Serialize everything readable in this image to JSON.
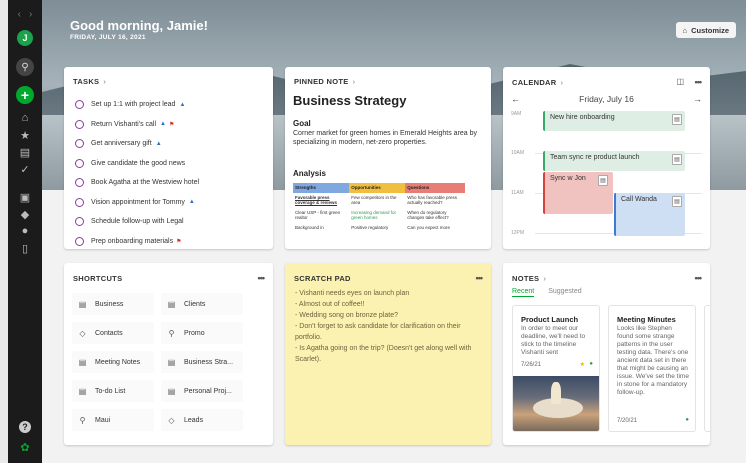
{
  "greeting": "Good morning, Jamie!",
  "date": "FRIDAY, JULY 16, 2021",
  "customize_label": "Customize",
  "sidebar": {
    "avatar_initial": "J"
  },
  "tasks": {
    "title": "TASKS",
    "items": [
      {
        "label": "Set up 1:1 with project lead",
        "flags": [
          "blue"
        ]
      },
      {
        "label": "Return Vishanti's call",
        "flags": [
          "blue",
          "red"
        ]
      },
      {
        "label": "Get anniversary gift",
        "flags": [
          "blue"
        ]
      },
      {
        "label": "Give candidate the good news",
        "flags": []
      },
      {
        "label": "Book Agatha at the Westview hotel",
        "flags": []
      },
      {
        "label": "Vision appointment for Tommy",
        "flags": [
          "blue"
        ]
      },
      {
        "label": "Schedule follow-up with Legal",
        "flags": []
      },
      {
        "label": "Prep onboarding materials",
        "flags": [
          "red"
        ]
      }
    ]
  },
  "pinned": {
    "header": "PINNED NOTE",
    "title": "Business Strategy",
    "goal_heading": "Goal",
    "goal_text": "Corner market for green homes in Emerald Heights area by specializing in modern, net-zero properties.",
    "analysis_heading": "Analysis",
    "table_headers": [
      "Strengths",
      "Opportunities",
      "Questions"
    ],
    "table_rows": [
      [
        "Favorable press coverage & reviews",
        "Few competitors in the area",
        "Who has favorable press actually reached?"
      ],
      [
        "Clear USP - first green realtor",
        "Increasing demand for green homes",
        "When do regulatory changes take effect?"
      ],
      [
        "Background in",
        "Positive regulatory",
        "Can you expect more"
      ]
    ]
  },
  "calendar": {
    "title": "CALENDAR",
    "day": "Friday, July 16",
    "hours": [
      "9AM",
      "10AM",
      "11AM",
      "12PM"
    ],
    "events": [
      "New hire onboarding",
      "Team sync re product launch",
      "Sync w Jon",
      "Call Wanda"
    ]
  },
  "shortcuts": {
    "title": "SHORTCUTS",
    "items": [
      {
        "label": "Business",
        "icon": "notebook-icon"
      },
      {
        "label": "Clients",
        "icon": "notebook-icon"
      },
      {
        "label": "Contacts",
        "icon": "tag-icon"
      },
      {
        "label": "Promo",
        "icon": "search-icon"
      },
      {
        "label": "Meeting Notes",
        "icon": "note-icon"
      },
      {
        "label": "Business Stra...",
        "icon": "note-icon"
      },
      {
        "label": "To-do List",
        "icon": "note-icon"
      },
      {
        "label": "Personal Proj...",
        "icon": "note-icon"
      },
      {
        "label": "Maui",
        "icon": "search-icon"
      },
      {
        "label": "Leads",
        "icon": "tag-icon"
      }
    ]
  },
  "scratch": {
    "title": "SCRATCH PAD",
    "lines": [
      "- Vishanti needs eyes on launch plan",
      "- Almost out of coffee!!",
      "- Wedding song on bronze plate?",
      "- Don't forget to ask candidate for clarification on their portfolio.",
      "- Is Agatha going on the trip? (Doesn't get along well with Scarlet)."
    ]
  },
  "notes": {
    "title": "NOTES",
    "tab_recent": "Recent",
    "tab_suggested": "Suggested",
    "cards": [
      {
        "title": "Product Launch",
        "body": "In order to meet our deadline, we'll need to stick to the timeline Vishanti sent",
        "date": "7/26/21"
      },
      {
        "title": "Meeting Minutes",
        "body": "Looks like Stephen found some strange patterns in the user testing data. There's one ancient data set in there that might be causing an issue. We've set the time in stone for a mandatory follow-up.",
        "date": "7/20/21"
      }
    ],
    "peek_title": "Y"
  }
}
